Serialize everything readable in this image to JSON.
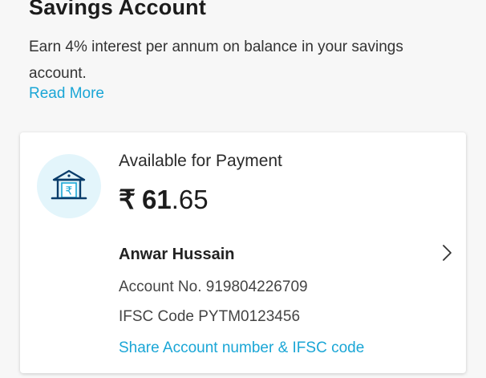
{
  "header": {
    "title": "Savings Account",
    "description": "Earn 4% interest per annum on balance in your savings account.",
    "read_more": "Read More"
  },
  "card": {
    "available_label": "Available for Payment",
    "balance": {
      "currency_symbol": "₹",
      "whole": "61",
      "decimal": ".65"
    },
    "holder_name": "Anwar Hussain",
    "account_number": "Account No. 919804226709",
    "ifsc": "IFSC Code PYTM0123456",
    "share_link": "Share Account number & IFSC code",
    "icons": {
      "bank": "bank-rupee-icon",
      "chevron": "chevron-right-icon"
    }
  },
  "colors": {
    "accent": "#1aa6d6",
    "icon_bg": "#e3f5fb",
    "icon_stroke": "#0a3d6b",
    "background": "#f7f7f7"
  }
}
